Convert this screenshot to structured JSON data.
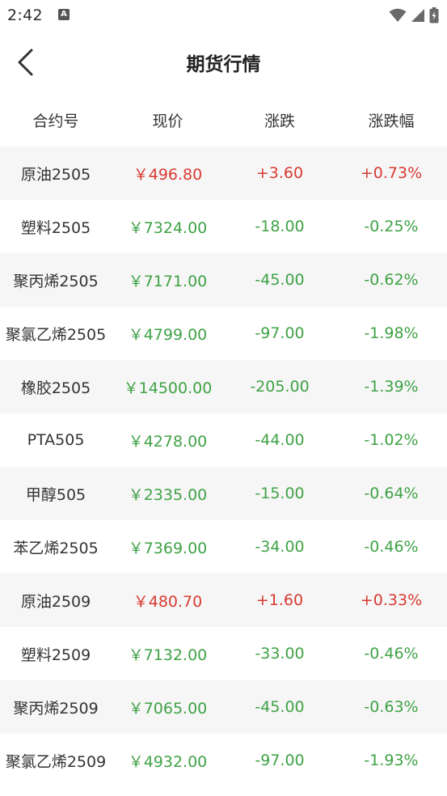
{
  "status_bar": {
    "time": "2:42",
    "notif_letter": "A"
  },
  "nav": {
    "title": "期货行情"
  },
  "header": {
    "col_contract": "合约号",
    "col_price": "现价",
    "col_change": "涨跌",
    "col_percent": "涨跌幅"
  },
  "colors": {
    "up": "#d83a32",
    "down": "#3fa245"
  },
  "rows": [
    {
      "name": "原油2505",
      "price": "￥496.80",
      "change": "+3.60",
      "percent": "+0.73%",
      "trend": "up"
    },
    {
      "name": "塑料2505",
      "price": "￥7324.00",
      "change": "-18.00",
      "percent": "-0.25%",
      "trend": "down"
    },
    {
      "name": "聚丙烯2505",
      "price": "￥7171.00",
      "change": "-45.00",
      "percent": "-0.62%",
      "trend": "down"
    },
    {
      "name": "聚氯乙烯2505",
      "price": "￥4799.00",
      "change": "-97.00",
      "percent": "-1.98%",
      "trend": "down"
    },
    {
      "name": "橡胶2505",
      "price": "￥14500.00",
      "change": "-205.00",
      "percent": "-1.39%",
      "trend": "down"
    },
    {
      "name": "PTA505",
      "price": "￥4278.00",
      "change": "-44.00",
      "percent": "-1.02%",
      "trend": "down"
    },
    {
      "name": "甲醇505",
      "price": "￥2335.00",
      "change": "-15.00",
      "percent": "-0.64%",
      "trend": "down"
    },
    {
      "name": "苯乙烯2505",
      "price": "￥7369.00",
      "change": "-34.00",
      "percent": "-0.46%",
      "trend": "down"
    },
    {
      "name": "原油2509",
      "price": "￥480.70",
      "change": "+1.60",
      "percent": "+0.33%",
      "trend": "up"
    },
    {
      "name": "塑料2509",
      "price": "￥7132.00",
      "change": "-33.00",
      "percent": "-0.46%",
      "trend": "down"
    },
    {
      "name": "聚丙烯2509",
      "price": "￥7065.00",
      "change": "-45.00",
      "percent": "-0.63%",
      "trend": "down"
    },
    {
      "name": "聚氯乙烯2509",
      "price": "￥4932.00",
      "change": "-97.00",
      "percent": "-1.93%",
      "trend": "down"
    }
  ]
}
